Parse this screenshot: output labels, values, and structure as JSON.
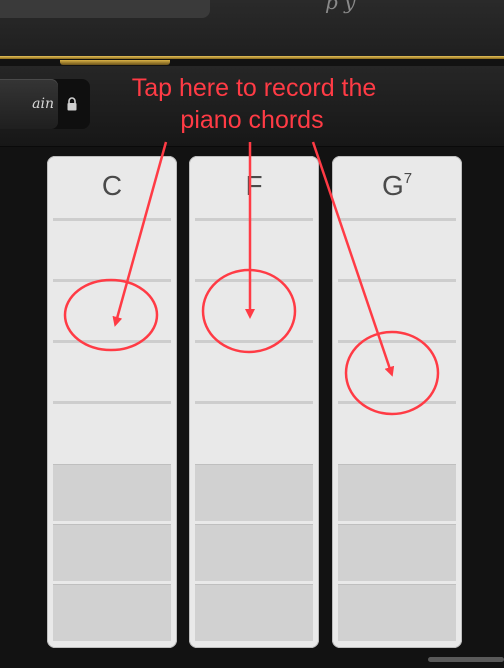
{
  "header": {
    "script_title": "p y"
  },
  "toolbar": {
    "chain_label": "ain"
  },
  "chords": [
    {
      "root": "C",
      "ext": ""
    },
    {
      "root": "F",
      "ext": ""
    },
    {
      "root": "G",
      "ext": "7"
    }
  ],
  "annotation": {
    "line1": "Tap here to record the",
    "line2": "piano chords"
  },
  "colors": {
    "accent_gold": "#e8c35a",
    "annotation_red": "#ff3b45",
    "strip_bg": "#e9e9e9"
  }
}
